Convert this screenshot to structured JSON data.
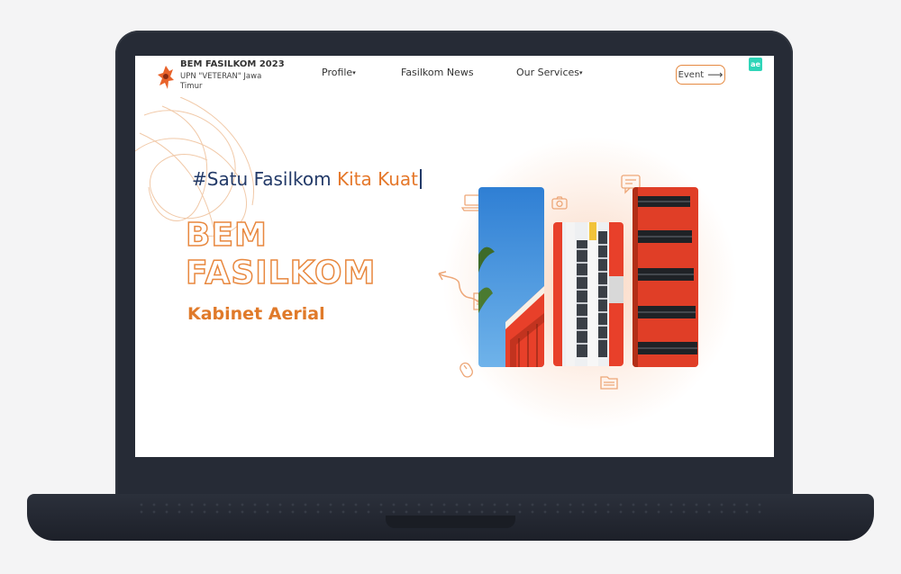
{
  "nav": {
    "brand_title": "BEM FASILKOM 2023",
    "brand_subtitle": "UPN \"VETERAN\" Jawa Timur",
    "items": [
      {
        "label": "Profile",
        "has_dropdown": true
      },
      {
        "label": "Fasilkom News",
        "has_dropdown": false
      },
      {
        "label": "Our Services",
        "has_dropdown": true
      }
    ],
    "event_button": "Event",
    "badge": "ae"
  },
  "hero": {
    "hashtag_part1": "#Satu Fasilkom ",
    "hashtag_part2": "Kita Kuat",
    "title_line1": "BEM",
    "title_line2": "FASILKOM",
    "subtitle": "Kabinet Aerial"
  },
  "icons": [
    "logo-icon",
    "laptop-icon",
    "camera-icon",
    "chat-icon",
    "arrow-icon",
    "mouse-icon",
    "folder-icon",
    "document-icon"
  ],
  "colors": {
    "accent_orange": "#e5782b",
    "navy": "#233a68",
    "laptop_body": "#262b36",
    "sky_blue": "#3a8fd8",
    "building_red": "#e8402a"
  }
}
